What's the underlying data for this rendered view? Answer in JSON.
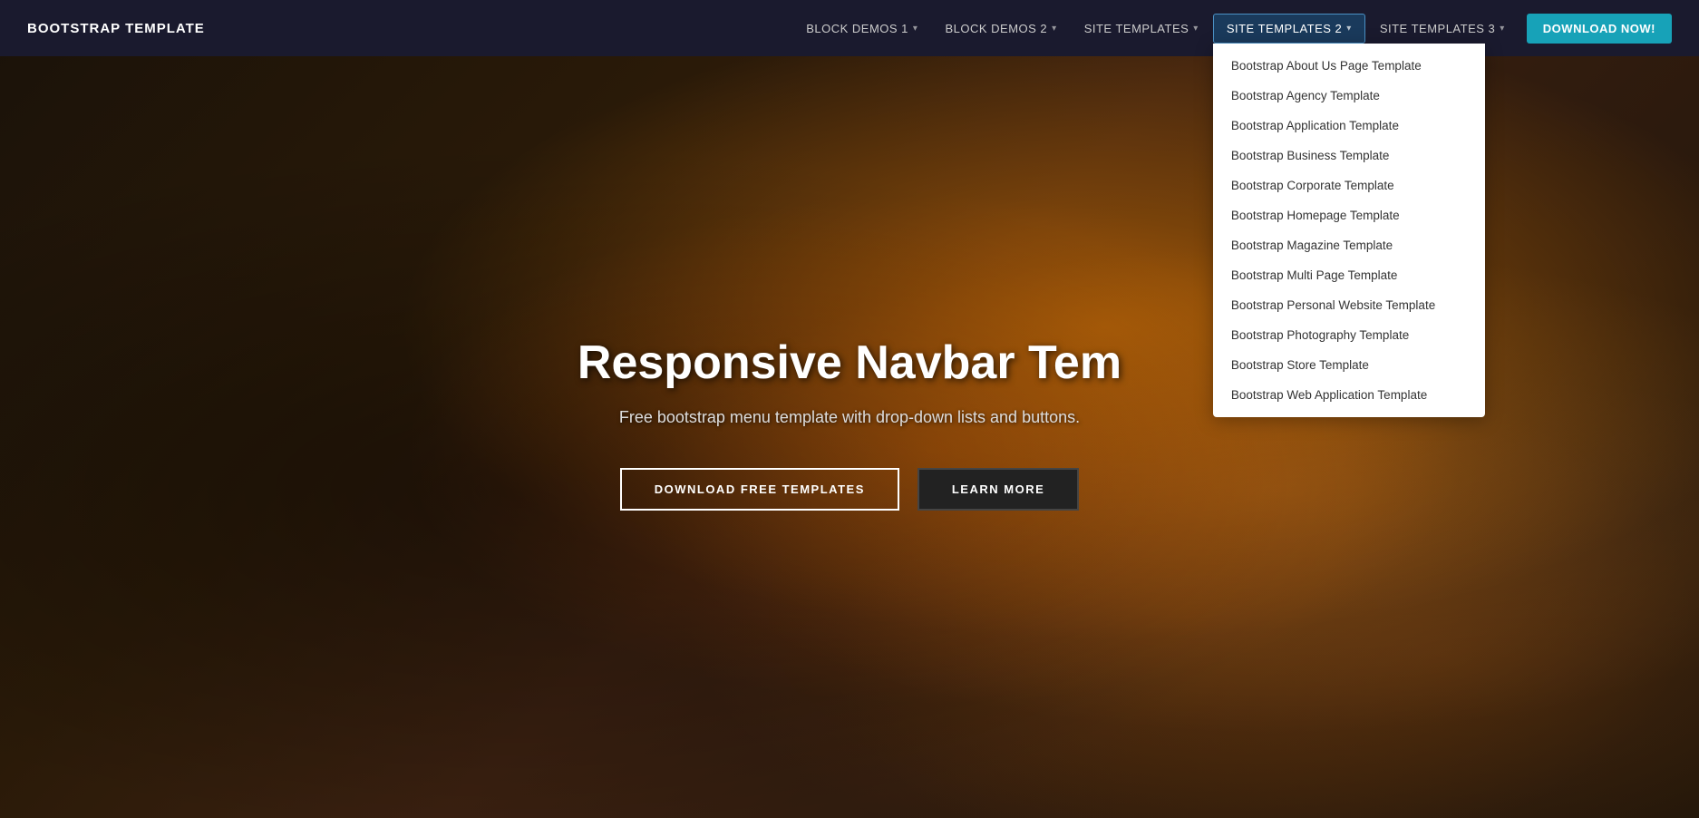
{
  "navbar": {
    "brand": "BOOTSTRAP TEMPLATE",
    "items": [
      {
        "id": "block-demos-1",
        "label": "BLOCK DEMOS 1",
        "has_dropdown": true,
        "active": false
      },
      {
        "id": "block-demos-2",
        "label": "BLOCK DEMOS 2",
        "has_dropdown": true,
        "active": false
      },
      {
        "id": "site-templates",
        "label": "SITE TEMPLATES",
        "has_dropdown": true,
        "active": false
      },
      {
        "id": "site-templates-2",
        "label": "SITE TEMPLATES 2",
        "has_dropdown": true,
        "active": true
      },
      {
        "id": "site-templates-3",
        "label": "SITE TEMPLATES 3",
        "has_dropdown": true,
        "active": false
      }
    ],
    "download_button": "DOWNLOAD NOW!"
  },
  "dropdown": {
    "items": [
      "Bootstrap About Us Page Template",
      "Bootstrap Agency Template",
      "Bootstrap Application Template",
      "Bootstrap Business Template",
      "Bootstrap Corporate Template",
      "Bootstrap Homepage Template",
      "Bootstrap Magazine Template",
      "Bootstrap Multi Page Template",
      "Bootstrap Personal Website Template",
      "Bootstrap Photography Template",
      "Bootstrap Store Template",
      "Bootstrap Web Application Template"
    ]
  },
  "hero": {
    "title": "Responsive Navbar Tem",
    "subtitle": "Free bootstrap menu template with drop-down lists and buttons.",
    "btn_download": "DOWNLOAD FREE TEMPLATES",
    "btn_learn": "LEARN MORE"
  }
}
